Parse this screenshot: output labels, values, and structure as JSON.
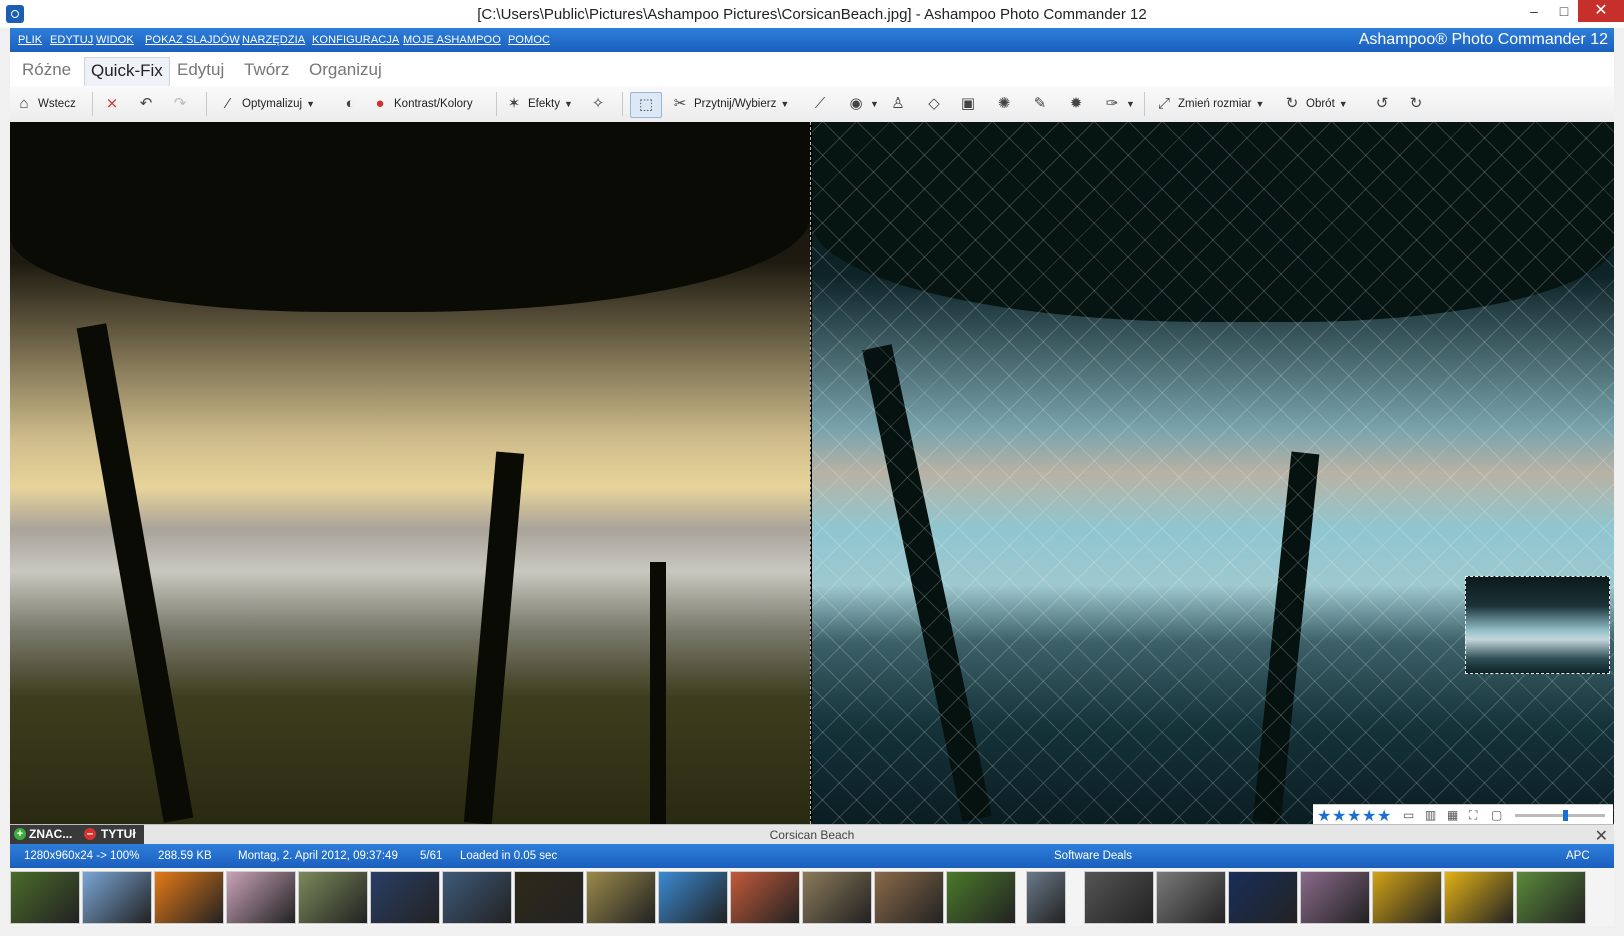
{
  "window": {
    "title": "[C:\\Users\\Public\\Pictures\\Ashampoo Pictures\\CorsicanBeach.jpg] - Ashampoo Photo Commander 12",
    "minimize": "–",
    "maximize": "□",
    "close": "✕"
  },
  "menu": {
    "items": [
      "PLIK",
      "EDYTUJ",
      "WIDOK",
      "POKAZ SLAJDÓW",
      "NARZĘDZIA",
      "KONFIGURACJA",
      "MOJE ASHAMPOO",
      "POMOC"
    ],
    "brand": "Ashampoo® Photo Commander 12"
  },
  "tabs": [
    "Różne",
    "Quick-Fix",
    "Edytuj",
    "Twórz",
    "Organizuj"
  ],
  "active_tab": "Quick-Fix",
  "toolbar": {
    "back": "Wstecz",
    "optimize": "Optymalizuj",
    "contrast": "Kontrast/Kolory",
    "effects": "Efekty",
    "crop": "Przytnij/Wybierz",
    "resize": "Zmień rozmiar",
    "rotate": "Obrót"
  },
  "icons": {
    "back": "house-icon",
    "delete": "delete-icon",
    "undo": "undo-icon",
    "redo": "redo-icon",
    "optimize": "magic-wand-icon",
    "brightness": "brightness-icon",
    "contrast": "color-circles-icon",
    "effects": "stars-icon",
    "sparkle": "sparkle-icon",
    "select": "lasso-select-icon",
    "crop": "scissors-icon",
    "straighten": "straighten-icon",
    "redeye": "eye-icon",
    "clone": "clone-stamp-icon",
    "eraser": "eraser-icon",
    "frame": "frame-icon",
    "palette": "palette-icon",
    "brush": "brush-icon",
    "splash": "splash-icon",
    "pen": "pen-icon",
    "resize": "resize-icon",
    "rotate": "rotate-icon",
    "rotate_left": "rotate-left-icon",
    "rotate_right": "rotate-right-icon"
  },
  "caption": {
    "tag_label": "ZNAC...",
    "title_label": "TYTUł",
    "photo_title": "Corsican Beach",
    "close": "✕"
  },
  "rating": {
    "stars": 5,
    "star_glyph": "★"
  },
  "status": {
    "dimensions": "1280x960x24 -> 100%",
    "size": "288.59 KB",
    "date": "Montag, 2. April 2012, 09:37:49",
    "position": "5/61",
    "load_time": "Loaded in 0.05 sec",
    "deals": "Software Deals",
    "apc": "APC"
  },
  "colors": {
    "accent": "#1b5fbe",
    "close_red": "#c7302a",
    "star_blue": "#1b6fd2"
  },
  "thumbnails": [
    {
      "name": "thumb-flowers-green",
      "color": "#4a6b2a"
    },
    {
      "name": "thumb-red-berries",
      "color": "#7aa6d6"
    },
    {
      "name": "thumb-orange-flower",
      "color": "#e47a16"
    },
    {
      "name": "thumb-pink-blossom",
      "color": "#c9a3b8"
    },
    {
      "name": "thumb-castle",
      "color": "#7a8a5a"
    },
    {
      "name": "thumb-night-city",
      "color": "#2a3e66"
    },
    {
      "name": "thumb-mountains",
      "color": "#3e5a7a"
    },
    {
      "name": "thumb-grass-silhouette",
      "color": "#2e2a1a"
    },
    {
      "name": "thumb-field",
      "color": "#9a8a4a"
    },
    {
      "name": "thumb-bicycle",
      "color": "#3a8ad2"
    },
    {
      "name": "thumb-rose",
      "color": "#c25a3a"
    },
    {
      "name": "thumb-shell",
      "color": "#8a7a5a"
    },
    {
      "name": "thumb-pebbles",
      "color": "#8a6a4a"
    },
    {
      "name": "thumb-pink-flower",
      "color": "#4a7a2a"
    },
    {
      "name": "thumb-pier",
      "color": "#6a7a8a"
    },
    {
      "name": "thumb-skyline",
      "color": "#555555"
    },
    {
      "name": "thumb-machine",
      "color": "#7a7a7a"
    },
    {
      "name": "thumb-moon",
      "color": "#1a2e5a"
    },
    {
      "name": "thumb-sunset-mill",
      "color": "#8a6a8a"
    },
    {
      "name": "thumb-sunflower",
      "color": "#d2a216"
    },
    {
      "name": "thumb-yellow-flower",
      "color": "#e2b216"
    },
    {
      "name": "thumb-dragonfly",
      "color": "#5a8a3a"
    }
  ]
}
